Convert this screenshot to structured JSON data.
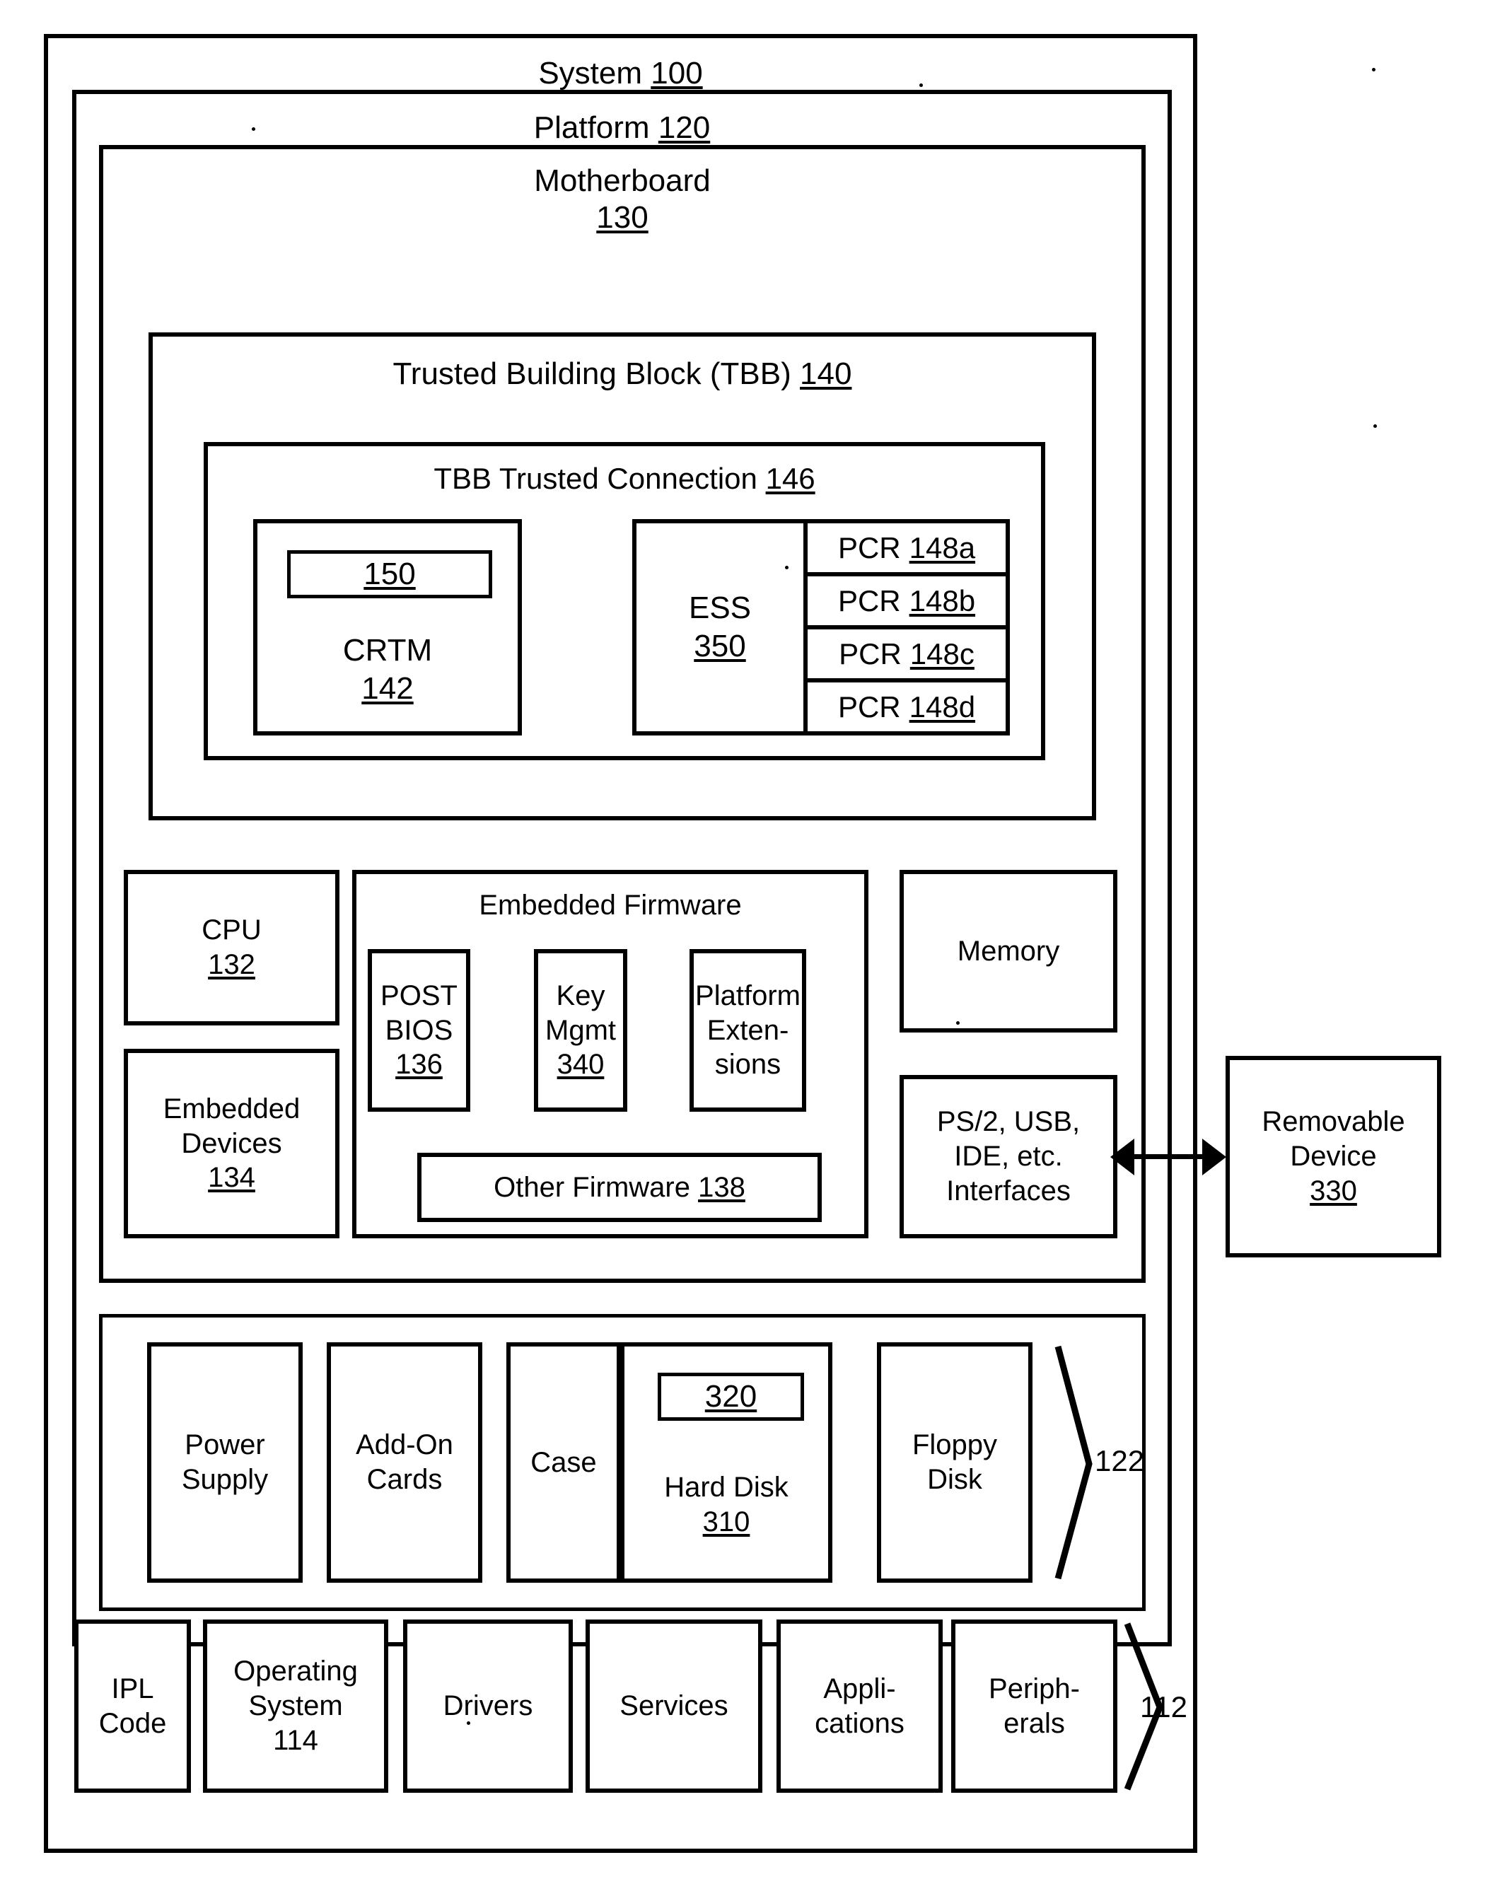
{
  "figure": {
    "type": "patent-block-diagram",
    "system": {
      "label": "System",
      "ref": "100"
    },
    "platform": {
      "label": "Platform",
      "ref": "120"
    },
    "motherboard": {
      "label": "Motherboard",
      "ref": "130"
    },
    "tbb": {
      "label": "Trusted Building Block (TBB)",
      "ref": "140"
    },
    "tbb_connection": {
      "label": "TBB Trusted Connection",
      "ref": "146"
    },
    "crtm": {
      "inner_ref": "150",
      "label": "CRTM",
      "ref": "142"
    },
    "ess": {
      "label": "ESS",
      "ref": "350"
    },
    "pcrs": [
      {
        "label": "PCR",
        "ref": "148a"
      },
      {
        "label": "PCR",
        "ref": "148b"
      },
      {
        "label": "PCR",
        "ref": "148c"
      },
      {
        "label": "PCR",
        "ref": "148d"
      }
    ],
    "cpu": {
      "label": "CPU",
      "ref": "132"
    },
    "embedded_devices": {
      "line1": "Embedded",
      "line2": "Devices",
      "ref": "134"
    },
    "embedded_firmware": {
      "title": "Embedded Firmware"
    },
    "firmware_items": [
      {
        "line1": "POST",
        "line2": "BIOS",
        "ref": "136"
      },
      {
        "line1": "Key",
        "line2": "Mgmt",
        "ref": "340"
      },
      {
        "line1": "Platform",
        "line2": "Exten-",
        "line3": "sions",
        "ref": ""
      }
    ],
    "other_firmware": {
      "label": "Other Firmware",
      "ref": "138"
    },
    "memory": {
      "label": "Memory"
    },
    "interfaces": {
      "line1": "PS/2, USB,",
      "line2": "IDE, etc.",
      "line3": "Interfaces"
    },
    "removable_device": {
      "line1": "Removable",
      "line2": "Device",
      "ref": "330"
    },
    "platform_components": [
      {
        "line1": "Power",
        "line2": "Supply",
        "ref": ""
      },
      {
        "line1": "Add-On",
        "line2": "Cards",
        "ref": ""
      },
      {
        "line1": "Case",
        "line2": "",
        "ref": ""
      },
      {
        "inner_ref": "320",
        "line1": "Hard Disk",
        "line2": "",
        "ref": "310"
      },
      {
        "line1": "Floppy",
        "line2": "Disk",
        "ref": ""
      }
    ],
    "platform_group_ref": "122",
    "system_components": [
      {
        "line1": "IPL",
        "line2": "Code"
      },
      {
        "line1": "Operating",
        "line2": "System",
        "line3": "114"
      },
      {
        "line1": "Drivers",
        "line2": ""
      },
      {
        "line1": "Services",
        "line2": ""
      },
      {
        "line1": "Appli-",
        "line2": "cations"
      },
      {
        "line1": "Periph-",
        "line2": "erals"
      }
    ],
    "system_group_ref": "112"
  }
}
